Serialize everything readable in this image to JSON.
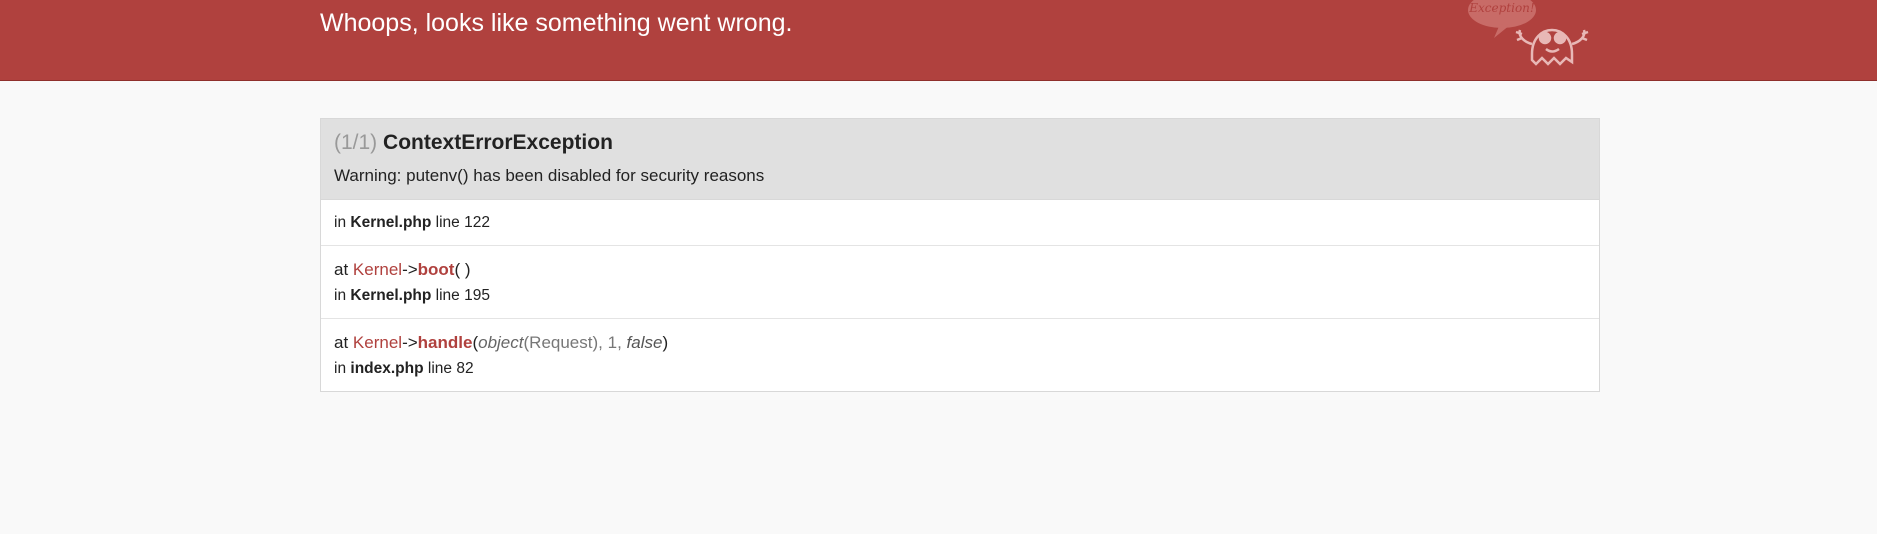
{
  "header": {
    "title": "Whoops, looks like something went wrong.",
    "logo_text": "Exception!",
    "bg_color": "#b0413e"
  },
  "exception": {
    "count": "(1/1)",
    "class": "ContextErrorException",
    "message": "Warning: putenv() has been disabled for security reasons"
  },
  "trace": [
    {
      "in_word": "in",
      "file": "Kernel.php",
      "line_word": "line",
      "line": "122"
    },
    {
      "at_word": "at",
      "class": "Kernel",
      "arrow": "->",
      "method": "boot",
      "args_open": "(",
      "args_close": " )",
      "in_word": "in",
      "file": "Kernel.php",
      "line_word": "line",
      "line": "195"
    },
    {
      "at_word": "at",
      "class": "Kernel",
      "arrow": "->",
      "method": "handle",
      "args_open": "(",
      "arg1_type": "object",
      "arg1_value": "(Request)",
      "arg_sep1": ", ",
      "arg2": "1",
      "arg_sep2": ", ",
      "arg3": "false",
      "args_close": ")",
      "in_word": "in",
      "file": "index.php",
      "line_word": "line",
      "line": "82"
    }
  ]
}
